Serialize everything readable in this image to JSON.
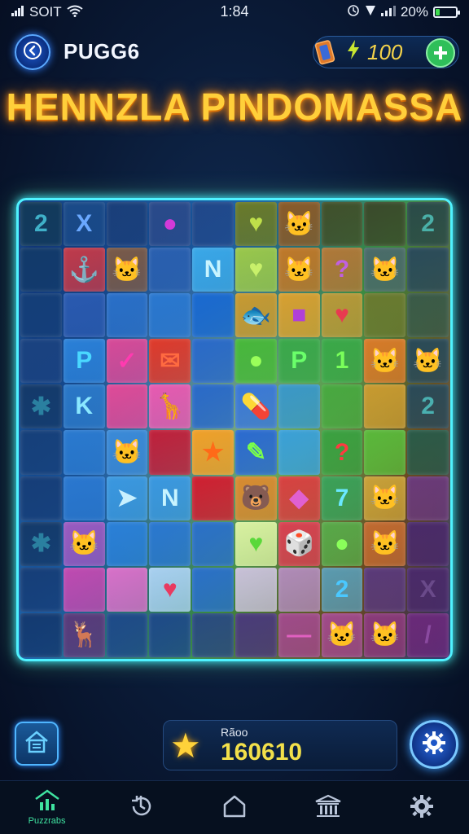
{
  "status_bar": {
    "carrier": "SOIT",
    "time": "1:84",
    "battery_text": "20%",
    "battery_level": 0.2
  },
  "header": {
    "player_name": "PUGG6",
    "coins": "100"
  },
  "title": "HENNZLA PINDOMASSA",
  "board": {
    "rows": [
      [
        {
          "g": "2",
          "c": "#123a5a",
          "t": "#3fb0c8"
        },
        {
          "g": "X",
          "c": "#1a4a88",
          "t": "#6aa8ff"
        },
        {
          "g": "",
          "c": "#1a3f7a",
          "t": ""
        },
        {
          "g": "●",
          "c": "#2a4a8a",
          "t": "#d23ad8"
        },
        {
          "g": "",
          "c": "#20488a",
          "t": ""
        },
        {
          "g": "♥",
          "c": "#6a7a28",
          "t": "#bfe04a"
        },
        {
          "g": "🐱",
          "c": "#8a5a28",
          "t": "#e8a060"
        },
        {
          "g": "",
          "c": "#40502a",
          "t": ""
        },
        {
          "g": "",
          "c": "#3a4a2a",
          "t": ""
        },
        {
          "g": "2",
          "c": "#2a4a48",
          "t": "#4ab0a8"
        }
      ],
      [
        {
          "g": "",
          "c": "#123a6a",
          "t": ""
        },
        {
          "g": "⚓",
          "c": "#c03a4a",
          "t": "#ff8a30"
        },
        {
          "g": "🐱",
          "c": "#7a5a48",
          "t": "#e8a058"
        },
        {
          "g": "",
          "c": "#2a60b0",
          "t": ""
        },
        {
          "g": "N",
          "c": "#3aa8e8",
          "t": "#c8f4ff"
        },
        {
          "g": "♥",
          "c": "#9ac84a",
          "t": "#c8f06a"
        },
        {
          "g": "🐱",
          "c": "#c07828",
          "t": "#f0b060"
        },
        {
          "g": "?",
          "c": "#b07838",
          "t": "#c060e0"
        },
        {
          "g": "🐱",
          "c": "#4a6a6a",
          "t": "#8ab0b0"
        },
        {
          "g": "",
          "c": "#2a4a5a",
          "t": ""
        }
      ],
      [
        {
          "g": "",
          "c": "#143e78",
          "t": ""
        },
        {
          "g": "",
          "c": "#2a5ab0",
          "t": ""
        },
        {
          "g": "",
          "c": "#2a70c8",
          "t": ""
        },
        {
          "g": "",
          "c": "#2a78d0",
          "t": ""
        },
        {
          "g": "",
          "c": "#1a6ad0",
          "t": ""
        },
        {
          "g": "🐟",
          "c": "#c89a30",
          "t": "#5a8a30"
        },
        {
          "g": "■",
          "c": "#d8a030",
          "t": "#b040d8"
        },
        {
          "g": "♥",
          "c": "#b89838",
          "t": "#e83a50"
        },
        {
          "g": "",
          "c": "#6a7a30",
          "t": ""
        },
        {
          "g": "",
          "c": "#3a5a48",
          "t": ""
        }
      ],
      [
        {
          "g": "",
          "c": "#1a4280",
          "t": ""
        },
        {
          "g": "P",
          "c": "#2a80d8",
          "t": "#4ad8ff"
        },
        {
          "g": "✓",
          "c": "#d84a98",
          "t": "#ff3ab0"
        },
        {
          "g": "✉",
          "c": "#e03a2a",
          "t": "#ff6a40"
        },
        {
          "g": "",
          "c": "#2a6ac8",
          "t": ""
        },
        {
          "g": "●",
          "c": "#48b83a",
          "t": "#9aff5a"
        },
        {
          "g": "P",
          "c": "#3aa84a",
          "t": "#6aff6a"
        },
        {
          "g": "1",
          "c": "#3aa848",
          "t": "#7aff5a"
        },
        {
          "g": "🐱",
          "c": "#d87a28",
          "t": "#ffb060"
        },
        {
          "g": "🐱",
          "c": "#2a4a58",
          "t": "#7a9aa0"
        }
      ],
      [
        {
          "g": "✱",
          "c": "#143a6a",
          "t": "#2a80a0"
        },
        {
          "g": "K",
          "c": "#2a78c8",
          "t": "#8ae8ff"
        },
        {
          "g": "",
          "c": "#e04a98",
          "t": ""
        },
        {
          "g": "🦒",
          "c": "#e85ab0",
          "t": "#ffb030"
        },
        {
          "g": "",
          "c": "#2a6ac8",
          "t": ""
        },
        {
          "g": "💊",
          "c": "#3a78d8",
          "t": "#ff3a98"
        },
        {
          "g": "",
          "c": "#3a98c8",
          "t": ""
        },
        {
          "g": "",
          "c": "#48a840",
          "t": ""
        },
        {
          "g": "",
          "c": "#c89a30",
          "t": ""
        },
        {
          "g": "2",
          "c": "#2a4a58",
          "t": "#4ab0b0"
        }
      ],
      [
        {
          "g": "",
          "c": "#16407a",
          "t": ""
        },
        {
          "g": "",
          "c": "#2a7ad0",
          "t": ""
        },
        {
          "g": "🐱",
          "c": "#3a8ad8",
          "t": "#5ac8ff"
        },
        {
          "g": "",
          "c": "#c0203a",
          "t": ""
        },
        {
          "g": "★",
          "c": "#f0a028",
          "t": "#ff6a18"
        },
        {
          "g": "✎",
          "c": "#2a6ad0",
          "t": "#7aff4a"
        },
        {
          "g": "",
          "c": "#3aa0d8",
          "t": ""
        },
        {
          "g": "?",
          "c": "#3aa040",
          "t": "#ff3a40"
        },
        {
          "g": "",
          "c": "#5ab83a",
          "t": ""
        },
        {
          "g": "",
          "c": "#2a5a48",
          "t": ""
        }
      ],
      [
        {
          "g": "",
          "c": "#163e78",
          "t": ""
        },
        {
          "g": "",
          "c": "#2a78d0",
          "t": ""
        },
        {
          "g": "➤",
          "c": "#3a98e0",
          "t": "#c8f0ff"
        },
        {
          "g": "N",
          "c": "#3a98e0",
          "t": "#c8f4ff"
        },
        {
          "g": "",
          "c": "#d01e30",
          "t": ""
        },
        {
          "g": "🐻",
          "c": "#d88a30",
          "t": "#a05a20"
        },
        {
          "g": "◆",
          "c": "#d84040",
          "t": "#e060d0"
        },
        {
          "g": "7",
          "c": "#3aa058",
          "t": "#6ae8ff"
        },
        {
          "g": "🐱",
          "c": "#c8a038",
          "t": "#f0a040"
        },
        {
          "g": "",
          "c": "#6a3a7a",
          "t": ""
        }
      ],
      [
        {
          "g": "✱",
          "c": "#143a6a",
          "t": "#2a80a0"
        },
        {
          "g": "🐱",
          "c": "#9a5ac0",
          "t": "#e8a0ff"
        },
        {
          "g": "",
          "c": "#2a80d8",
          "t": ""
        },
        {
          "g": "",
          "c": "#2a78d0",
          "t": ""
        },
        {
          "g": "",
          "c": "#2a70c8",
          "t": ""
        },
        {
          "g": "♥",
          "c": "#d8f0a0",
          "t": "#5ad83a"
        },
        {
          "g": "🎲",
          "c": "#d84050",
          "t": "#ff5a98"
        },
        {
          "g": "●",
          "c": "#58a848",
          "t": "#8aff5a"
        },
        {
          "g": "🐱",
          "c": "#c06a30",
          "t": "#ff9040"
        },
        {
          "g": "",
          "c": "#4a2a6a",
          "t": ""
        }
      ],
      [
        {
          "g": "",
          "c": "#163e78",
          "t": ""
        },
        {
          "g": "",
          "c": "#c04ab0",
          "t": ""
        },
        {
          "g": "",
          "c": "#d870c8",
          "t": ""
        },
        {
          "g": "♥",
          "c": "#a8d0f0",
          "t": "#e83a60"
        },
        {
          "g": "",
          "c": "#2a70c8",
          "t": ""
        },
        {
          "g": "",
          "c": "#c8c0d8",
          "t": ""
        },
        {
          "g": "",
          "c": "#b08ab8",
          "t": ""
        },
        {
          "g": "2",
          "c": "#5a9ab0",
          "t": "#4ac8ff"
        },
        {
          "g": "",
          "c": "#5a3a7a",
          "t": ""
        },
        {
          "g": "X",
          "c": "#4a2a6a",
          "t": "#6a4a8a"
        }
      ],
      [
        {
          "g": "",
          "c": "#143a70",
          "t": ""
        },
        {
          "g": "🦌",
          "c": "#5a3a7a",
          "t": "#b080b0"
        },
        {
          "g": "",
          "c": "#1e4a88",
          "t": ""
        },
        {
          "g": "",
          "c": "#1e4a88",
          "t": ""
        },
        {
          "g": "",
          "c": "#2a4a80",
          "t": ""
        },
        {
          "g": "",
          "c": "#4a3a7a",
          "t": ""
        },
        {
          "g": "—",
          "c": "#a04a8a",
          "t": "#e060c0"
        },
        {
          "g": "🐱",
          "c": "#a04a8a",
          "t": "#c8a0d8"
        },
        {
          "g": "🐱",
          "c": "#8a3a7a",
          "t": "#e06a80"
        },
        {
          "g": "/",
          "c": "#6a2a7a",
          "t": "#8a4aa0"
        }
      ]
    ]
  },
  "score": {
    "label": "Rãoo",
    "value": "160610"
  },
  "nav": {
    "items": [
      {
        "name": "nav-home",
        "label": "Puzzrabs"
      },
      {
        "name": "nav-history",
        "label": ""
      },
      {
        "name": "nav-house",
        "label": ""
      },
      {
        "name": "nav-shop",
        "label": ""
      },
      {
        "name": "nav-settings",
        "label": ""
      }
    ]
  },
  "colors": {
    "title": "#ffcf3a",
    "board_border": "#4ff2ff",
    "accent_green": "#2fbf5a",
    "nav_active": "#3fe2a0"
  }
}
